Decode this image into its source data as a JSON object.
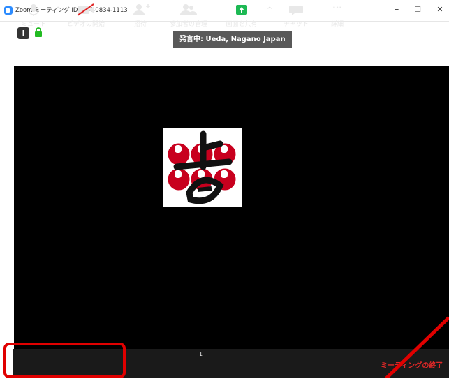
{
  "window": {
    "title": "Zoom ミーティング ID: 944-0834-1113",
    "controls": {
      "minimize": "–",
      "maximize": "☐",
      "close": "✕"
    }
  },
  "meeting": {
    "info_icon": "i",
    "speaker_label": "発言中: Ueda, Nagano Japan"
  },
  "toolbar": {
    "mute_label": "ミュート",
    "video_label": "ビデオの開始",
    "invite_label": "招待",
    "participants_label": "参加者の管理",
    "participants_count": "1",
    "share_label": "画面を共有",
    "chat_label": "チャット",
    "more_label": "詳細",
    "more_icon": "···",
    "caret": "^",
    "end_label": "ミーティングの終了"
  },
  "colors": {
    "accent_blue": "#2d8cff",
    "share_green": "#1db954",
    "end_red": "#e02828",
    "lock_green": "#22bb22",
    "highlight_red": "#e00000"
  }
}
